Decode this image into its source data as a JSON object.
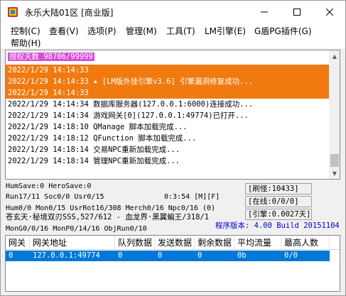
{
  "window": {
    "title": "永乐大陆01区 [商业版]"
  },
  "menu": [
    "控制(C)",
    "查看(V)",
    "选项(P)",
    "管理(M)",
    "工具(T)",
    "LM引擎(E)",
    "G盾PG插件(G)",
    "帮助(H)"
  ],
  "log": [
    {
      "type": "auth",
      "text": "授权天数 98706/99999"
    },
    {
      "type": "alert",
      "text": "2022/1/29 14:14:33"
    },
    {
      "type": "alert",
      "text": "2022/1/29 14:14:33 ★ [LM版外挂引擎v3.6] 引擎漏洞修复成功..."
    },
    {
      "type": "alert",
      "text": "2022/1/29 14:14:33"
    },
    {
      "type": "normal",
      "text": "2022/1/29 14:14:34 数据库服务器(127.0.0.1:6000)连接成功..."
    },
    {
      "type": "normal",
      "text": "2022/1/29 14:14:34 游戏网关[0](127.0.0.1:49774)已打开..."
    },
    {
      "type": "normal",
      "text": "2022/1/29 14:18:10 QManage 脚本加载完成..."
    },
    {
      "type": "normal",
      "text": "2022/1/29 14:18:12 QFunction 脚本加载完成..."
    },
    {
      "type": "normal",
      "text": "2022/1/29 14:18:14 交易NPC重新加载完成..."
    },
    {
      "type": "normal",
      "text": "2022/1/29 14:18:14 管理NPC重新加载完成..."
    }
  ],
  "status": {
    "line1": "HumSave:0 HeroSave:0",
    "line2": "Run17/11 Soc0/0 Usr0/15",
    "runtime": "0:3:54 [M][F]",
    "line3": "Hum0/0 Mon0/15 UsrRot16/308 Merch0/16 Npc0/16 (0)",
    "line4": "苍玄天·秘境双刃SSS,527/612 - 血龙界·黑翼蝙王/318/1",
    "line5": "MonG0/0/16 MonP0/14/16 ObjRun0/10",
    "refresh": "[刷怪:10433]",
    "online": "[在线:0/0/0]",
    "engine": "[引擎:0.0027天]",
    "version": "程序版本: 4.00 Build 20151104"
  },
  "table": {
    "columns": [
      "网关",
      "网关地址",
      "队列数据",
      "发送数据",
      "剩余数据",
      "平均流量",
      "最高人数"
    ],
    "rows": [
      [
        "0",
        "127.0.0.1:49774",
        "0",
        "0",
        "0",
        "0b",
        "0/0"
      ]
    ]
  },
  "colors": {
    "auth_bg": "#d94cd9",
    "alert_bg": "#f07a10",
    "selected_row": "#0078d7",
    "version_text": "#0000cc"
  }
}
